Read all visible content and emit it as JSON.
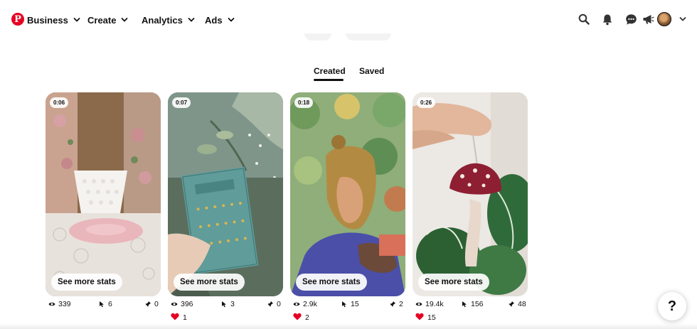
{
  "nav": {
    "items": [
      {
        "label": "Business"
      },
      {
        "label": "Create"
      },
      {
        "label": "Analytics"
      },
      {
        "label": "Ads"
      }
    ],
    "icons": [
      "search-icon",
      "notifications-bell-icon",
      "messages-icon",
      "megaphone-icon",
      "avatar",
      "account-chevron-icon"
    ]
  },
  "tabs": [
    {
      "label": "Created",
      "active": true
    },
    {
      "label": "Saved",
      "active": false
    }
  ],
  "pins": [
    {
      "duration": "0:06",
      "stats_label": "See more stats",
      "views": "339",
      "clicks": "6",
      "saves": "0",
      "reactions": null
    },
    {
      "duration": "0:07",
      "stats_label": "See more stats",
      "views": "396",
      "clicks": "3",
      "saves": "0",
      "reactions": "1"
    },
    {
      "duration": "0:18",
      "stats_label": "See more stats",
      "views": "2.9k",
      "clicks": "15",
      "saves": "2",
      "reactions": "2"
    },
    {
      "duration": "0:26",
      "stats_label": "See more stats",
      "views": "19.4k",
      "clicks": "156",
      "saves": "48",
      "reactions": "15"
    }
  ],
  "help": {
    "label": "?"
  },
  "colors": {
    "brand": "#e60023",
    "text": "#111111",
    "reaction": "#e60023"
  }
}
